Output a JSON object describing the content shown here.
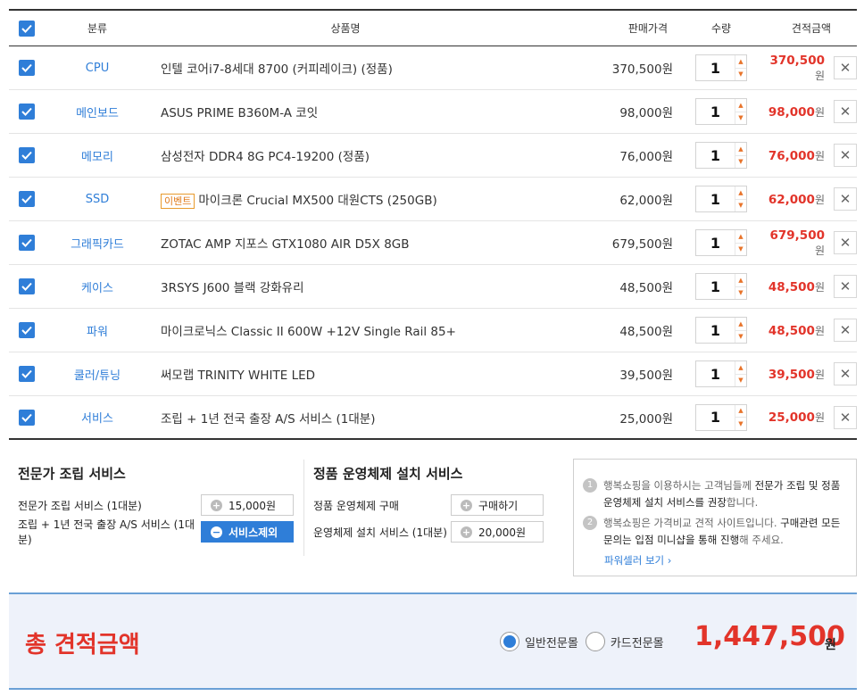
{
  "header": {
    "category": "분류",
    "name": "상품명",
    "price": "판매가격",
    "qty": "수량",
    "total": "견적금액"
  },
  "won": "원",
  "items": [
    {
      "category": "CPU",
      "event": "",
      "name": "인텔 코어i7-8세대 8700 (커피레이크) (정품)",
      "price": "370,500원",
      "qty": "1",
      "total": "370,500"
    },
    {
      "category": "메인보드",
      "event": "",
      "name": "ASUS PRIME B360M-A 코잇",
      "price": "98,000원",
      "qty": "1",
      "total": "98,000"
    },
    {
      "category": "메모리",
      "event": "",
      "name": "삼성전자 DDR4 8G PC4-19200 (정품)",
      "price": "76,000원",
      "qty": "1",
      "total": "76,000"
    },
    {
      "category": "SSD",
      "event": "이벤트",
      "name": "마이크론 Crucial MX500 대원CTS (250GB)",
      "price": "62,000원",
      "qty": "1",
      "total": "62,000"
    },
    {
      "category": "그래픽카드",
      "event": "",
      "name": "ZOTAC AMP 지포스 GTX1080 AIR D5X 8GB",
      "price": "679,500원",
      "qty": "1",
      "total": "679,500"
    },
    {
      "category": "케이스",
      "event": "",
      "name": "3RSYS J600 블랙 강화유리",
      "price": "48,500원",
      "qty": "1",
      "total": "48,500"
    },
    {
      "category": "파워",
      "event": "",
      "name": "마이크로닉스 Classic II 600W +12V Single Rail 85+",
      "price": "48,500원",
      "qty": "1",
      "total": "48,500"
    },
    {
      "category": "쿨러/튜닝",
      "event": "",
      "name": "써모랩 TRINITY WHITE LED",
      "price": "39,500원",
      "qty": "1",
      "total": "39,500"
    },
    {
      "category": "서비스",
      "event": "",
      "name": "조립 + 1년 전국 출장 A/S 서비스 (1대분)",
      "price": "25,000원",
      "qty": "1",
      "total": "25,000"
    }
  ],
  "assembly": {
    "title": "전문가 조립 서비스",
    "row1_label": "전문가 조립 서비스 (1대분)",
    "row1_btn": "15,000원",
    "row2_label": "조립 + 1년 전국 출장 A/S 서비스 (1대분)",
    "row2_btn": "서비스제외"
  },
  "os": {
    "title": "정품 운영체제 설치 서비스",
    "row1_label": "정품 운영체제 구매",
    "row1_btn": "구매하기",
    "row2_label": "운영체제 설치 서비스 (1대분)",
    "row2_btn": "20,000원"
  },
  "notice": {
    "n1": "1",
    "n2": "2",
    "line1_a": "행복쇼핑을 이용하시는 고객님들께 ",
    "line1_b": "전문가 조립 및 정품 운영체제 설치 서비스를 권장",
    "line1_c": "합니다.",
    "line2_a": "행복쇼핑은 가격비교 견적 사이트입니다. ",
    "line2_b": "구매관련 모든 문의는 입점 미니샵을 통해 진행",
    "line2_c": "해 주세요.",
    "link": "파워셀러 보기 ›"
  },
  "summary": {
    "label": "총 견적금액",
    "radio1": "일반전문몰",
    "radio2": "카드전문몰",
    "amount": "1,447,500",
    "unit": "원"
  },
  "colors": {
    "accent_blue": "#2f7ed8",
    "price_red": "#e2342a",
    "event_orange": "#e07b1c"
  }
}
